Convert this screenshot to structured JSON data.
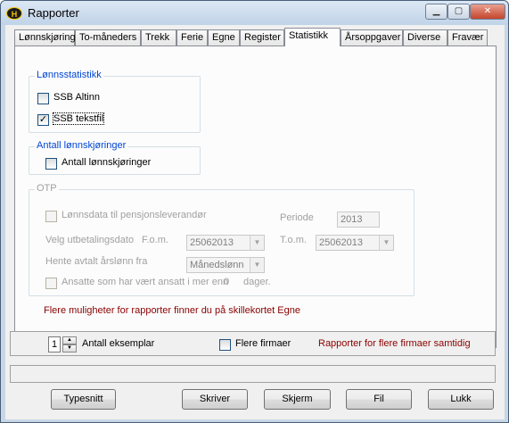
{
  "window": {
    "title": "Rapporter",
    "app_icon": "H"
  },
  "tabs": [
    {
      "label": "Lønnskjøring"
    },
    {
      "label": "To-måneders"
    },
    {
      "label": "Trekk"
    },
    {
      "label": "Ferie"
    },
    {
      "label": "Egne"
    },
    {
      "label": "Register"
    },
    {
      "label": "Statistikk"
    },
    {
      "label": "Årsoppgaver"
    },
    {
      "label": "Diverse"
    },
    {
      "label": "Fravær"
    }
  ],
  "active_tab": "Statistikk",
  "lonnsstatistikk": {
    "title": "Lønnsstatistikk",
    "ssb_altinn": {
      "label": "SSB Altinn",
      "checked": false
    },
    "ssb_tekstfil": {
      "label": "SSB tekstfil",
      "checked": true,
      "mark": "✓"
    }
  },
  "antall": {
    "title": "Antall lønnskjøringer",
    "checkbox": {
      "label": "Antall lønnskjøringer",
      "checked": false
    }
  },
  "otp": {
    "title": "OTP",
    "lonnsdata": {
      "label": "Lønnsdata til pensjonsleverandør",
      "checked": false
    },
    "periode_label": "Periode",
    "periode_value": "2013",
    "utbetaling_label": "Velg utbetalingsdato",
    "fom_label": "F.o.m.",
    "fom_value": "25062013",
    "tom_label": "T.o.m.",
    "tom_value": "25062013",
    "arslonn_label": "Hente avtalt årslønn fra",
    "arslonn_value": "Månedslønn",
    "ansatte": {
      "label": "Ansatte som har vært ansatt i mer enn",
      "days": "0",
      "suffix": "dager.",
      "checked": false
    }
  },
  "info_text": "Flere muligheter for rapporter finner du på skillekortet Egne",
  "bottom": {
    "eksemplar_value": "1",
    "eksemplar_label": "Antall eksemplar",
    "flere_firmaer_label": "Flere firmaer",
    "flere_firmaer_info": "Rapporter for flere firmaer samtidig"
  },
  "buttons": {
    "typesnitt": "Typesnitt",
    "skriver": "Skriver",
    "skjerm": "Skjerm",
    "fil": "Fil",
    "lukk": "Lukk"
  },
  "colors": {
    "group_title": "#0046d5",
    "info_red": "#8b0000"
  }
}
